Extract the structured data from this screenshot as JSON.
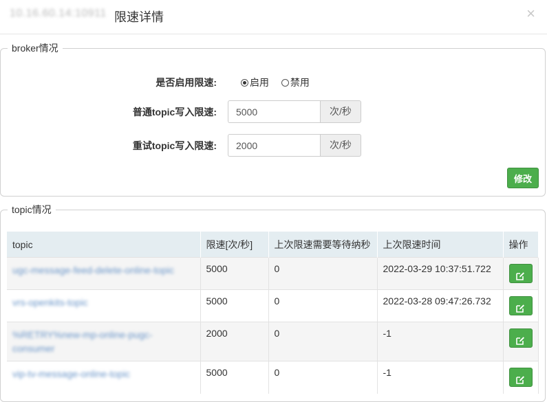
{
  "header": {
    "host": "10.16.60.14:10911",
    "title": "限速详情",
    "close": "×"
  },
  "broker": {
    "legend": "broker情况",
    "enabled_label": "是否启用限速:",
    "enable_option": "启用",
    "disable_option": "禁用",
    "enabled": true,
    "normal_label": "普通topic写入限速:",
    "normal_value": "5000",
    "retry_label": "重试topic写入限速:",
    "retry_value": "2000",
    "unit": "次/秒",
    "save_label": "修改"
  },
  "topics": {
    "legend": "topic情况",
    "columns": [
      "topic",
      "限速[次/秒]",
      "上次限速需要等待纳秒",
      "上次限速时间",
      "操作"
    ],
    "rows": [
      {
        "topic": "ugc-message-feed-delete-online-topic",
        "limit": "5000",
        "wait": "0",
        "time": "2022-03-29 10:37:51.722"
      },
      {
        "topic": "vrs-openkits-topic",
        "limit": "5000",
        "wait": "0",
        "time": "2022-03-28 09:47:26.732"
      },
      {
        "topic": "%RETRY%new-mp-online-pugc-consumer",
        "limit": "2000",
        "wait": "0",
        "time": "-1"
      },
      {
        "topic": "vip-tv-message-online-topic",
        "limit": "5000",
        "wait": "0",
        "time": "-1"
      }
    ]
  }
}
